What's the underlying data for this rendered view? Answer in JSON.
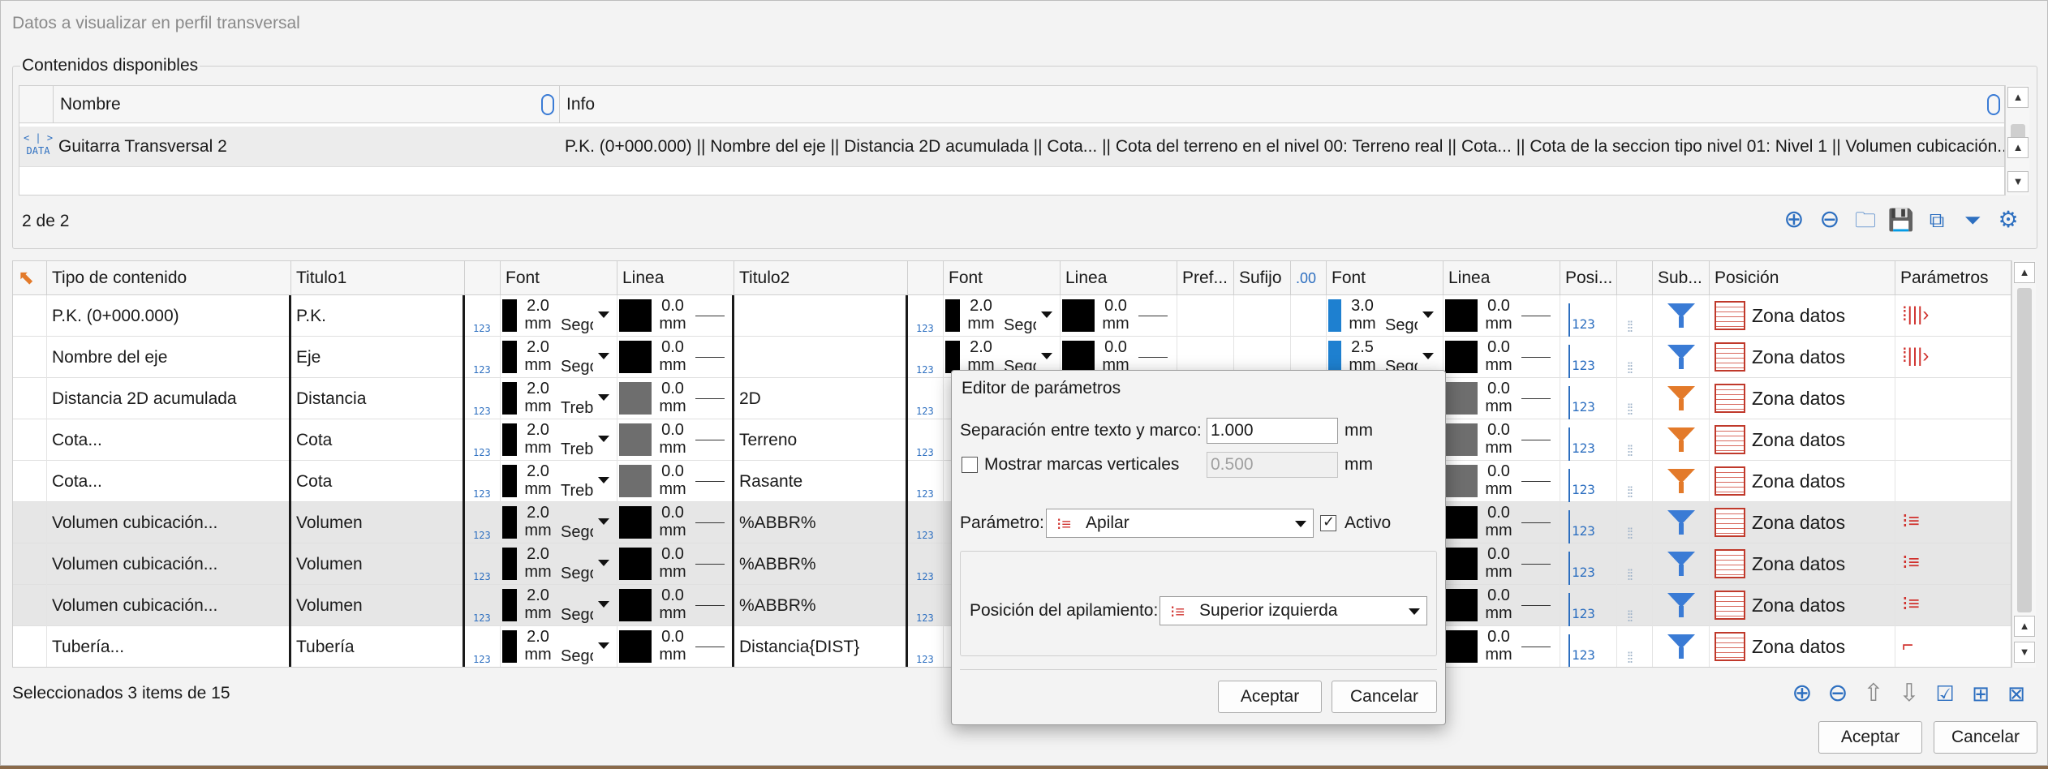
{
  "window": {
    "title": "Datos a visualizar en perfil transversal"
  },
  "available": {
    "group_title": "Contenidos disponibles",
    "headers": [
      "Nombre",
      "Info"
    ],
    "row": {
      "icon_text_top": "< | >",
      "icon_text_bottom": "DATA",
      "name": "Guitarra Transversal 2",
      "info": "P.K. (0+000.000) || Nombre del eje || Distancia 2D acumulada || Cota... || Cota del terreno en el nivel 00: Terreno real || Cota... || Cota de la seccion tipo nivel 01: Nivel 1 || Volumen cubicación... |..."
    },
    "count": "2 de 2"
  },
  "grid": {
    "headers": {
      "tipo": "Tipo de contenido",
      "titulo1": "Titulo1",
      "font1": "Font",
      "linea1": "Linea",
      "titulo2": "Titulo2",
      "font2": "Font",
      "linea2": "Linea",
      "pref": "Pref...",
      "sufijo": "Sufijo",
      "dec": ".00",
      "font3": "Font",
      "linea3": "Linea",
      "posi": "Posi...",
      "sub": "Sub...",
      "posicion": "Posición",
      "parametros": "Parámetros"
    },
    "rows": [
      {
        "tipo": "P.K. (0+000.000)",
        "titulo1": "P.K.",
        "f1size": "2.0",
        "f1name": "Segoe",
        "l1val": "0.0",
        "titulo2": "",
        "f2size": "2.0",
        "f2name": "Segoe",
        "l2val": "0.0",
        "f3size": "3.0",
        "f3name": "Segoe",
        "l3val": "0.0",
        "zone": "Zona datos"
      },
      {
        "tipo": "Nombre del eje",
        "titulo1": "Eje",
        "f1size": "2.0",
        "f1name": "Segoe",
        "l1val": "0.0",
        "titulo2": "",
        "f2size": "2.0",
        "f2name": "Segoe",
        "l2val": "0.0",
        "f3size": "2.5",
        "f3name": "Segoe",
        "l3val": "0.0",
        "zone": "Zona datos"
      },
      {
        "tipo": "Distancia 2D acumulada",
        "titulo1": "Distancia",
        "f1size": "2.0",
        "f1name": "Trebuchet",
        "l1val": "0.0",
        "titulo2": "2D",
        "l3val": "0.0",
        "zone": "Zona datos"
      },
      {
        "tipo": "Cota...",
        "titulo1": "Cota",
        "f1size": "2.0",
        "f1name": "Trebuchet",
        "l1val": "0.0",
        "titulo2": "Terreno",
        "l3val": "0.0",
        "zone": "Zona datos"
      },
      {
        "tipo": "Cota...",
        "titulo1": "Cota",
        "f1size": "2.0",
        "f1name": "Trebuchet",
        "l1val": "0.0",
        "titulo2": "Rasante",
        "l3val": "0.0",
        "zone": "Zona datos"
      },
      {
        "tipo": "Volumen cubicación...",
        "titulo1": "Volumen",
        "f1size": "2.0",
        "f1name": "Segoe",
        "l1val": "0.0",
        "titulo2": "%ABBR%",
        "l3val": "0.0",
        "zone": "Zona datos"
      },
      {
        "tipo": "Volumen cubicación...",
        "titulo1": "Volumen",
        "f1size": "2.0",
        "f1name": "Segoe",
        "l1val": "0.0",
        "titulo2": "%ABBR%",
        "l3val": "0.0",
        "zone": "Zona datos"
      },
      {
        "tipo": "Volumen cubicación...",
        "titulo1": "Volumen",
        "f1size": "2.0",
        "f1name": "Segoe",
        "l1val": "0.0",
        "titulo2": "%ABBR%",
        "l3val": "0.0",
        "zone": "Zona datos"
      },
      {
        "tipo": "Tubería...",
        "titulo1": "Tubería",
        "f1size": "2.0",
        "f1name": "Segoe",
        "l1val": "0.0",
        "titulo2": "Distancia{DIST}",
        "l3val": "0.0",
        "zone": "Zona datos"
      }
    ],
    "mm_unit": "mm",
    "icon_123": "123",
    "status": "Seleccionados 3 items de 15"
  },
  "buttons": {
    "accept": "Aceptar",
    "cancel": "Cancelar"
  },
  "modal": {
    "title": "Editor de parámetros",
    "sep_label": "Separación entre texto y marco:",
    "sep_value": "1.000",
    "sep_unit": "mm",
    "marks_label": "Mostrar marcas verticales",
    "marks_value": "0.500",
    "marks_unit": "mm",
    "param_label": "Parámetro:",
    "param_value": "Apilar",
    "active_label": "Activo",
    "stack_label": "Posición del apilamiento:",
    "stack_value": "Superior izquierda",
    "accept": "Aceptar",
    "cancel": "Cancelar"
  }
}
